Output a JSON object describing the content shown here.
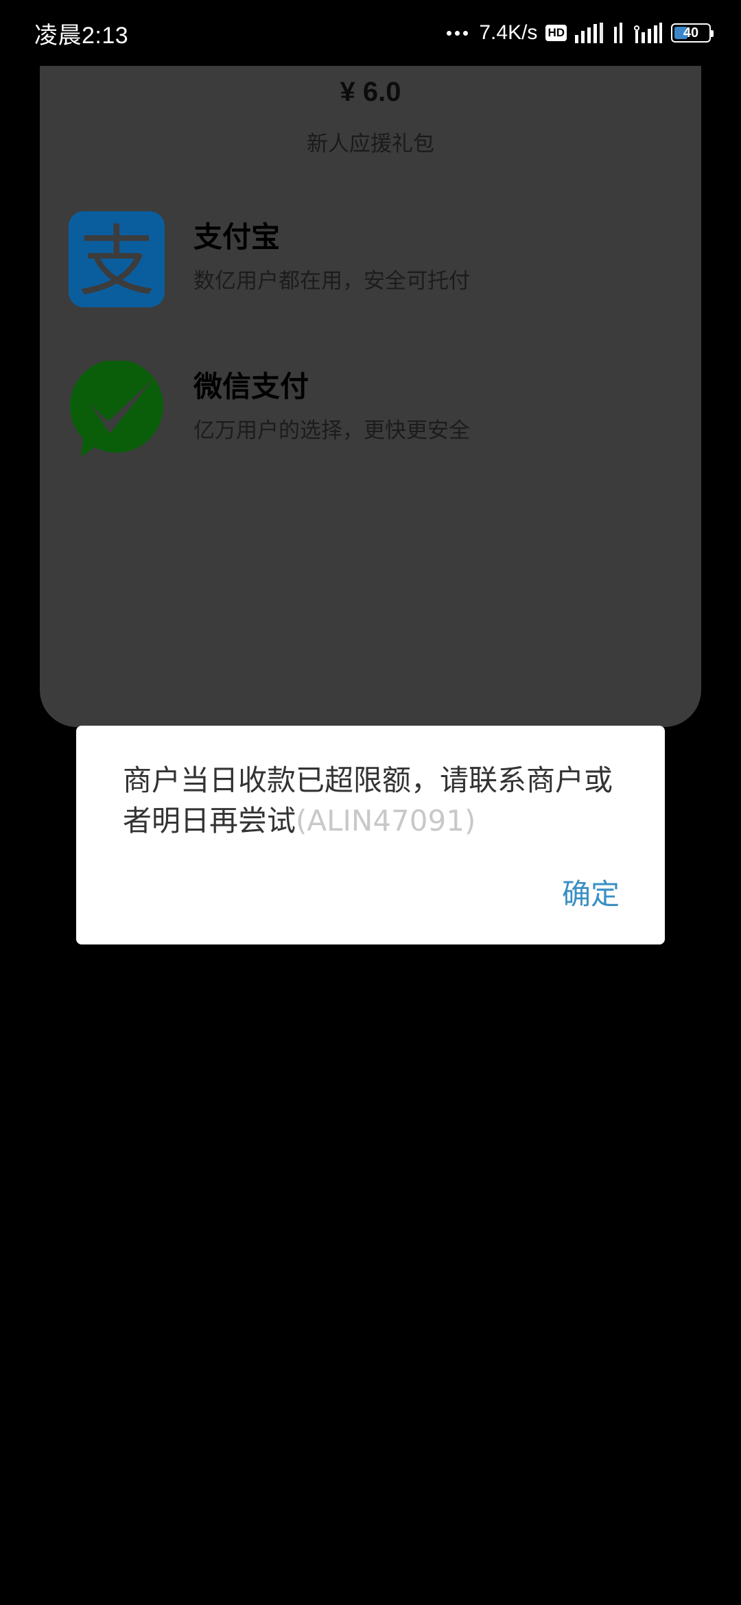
{
  "status_bar": {
    "time": "凌晨2:13",
    "network_speed": "7.4K/s",
    "hd_label": "HD",
    "battery_level": "40",
    "battery_fraction": 0.4,
    "icons": [
      "more-dots-icon",
      "hd-icon",
      "signal-icon",
      "wifi-icon",
      "signal-icon",
      "battery-icon"
    ]
  },
  "payment_sheet": {
    "price": "¥ 6.0",
    "package_name": "新人应援礼包",
    "options": [
      {
        "title": "支付宝",
        "description": "数亿用户都在用，安全可托付",
        "icon": "alipay-logo-icon",
        "color": "#0b5e9e"
      },
      {
        "title": "微信支付",
        "description": "亿万用户的选择，更快更安全",
        "icon": "wechat-pay-logo-icon",
        "color": "#0a5e0a"
      }
    ]
  },
  "dialog": {
    "message": "商户当日收款已超限额，请联系商户或者明日再尝试",
    "error_code": "(ALIN47091)",
    "confirm_label": "确定",
    "confirm_color": "#3a8fc4"
  }
}
